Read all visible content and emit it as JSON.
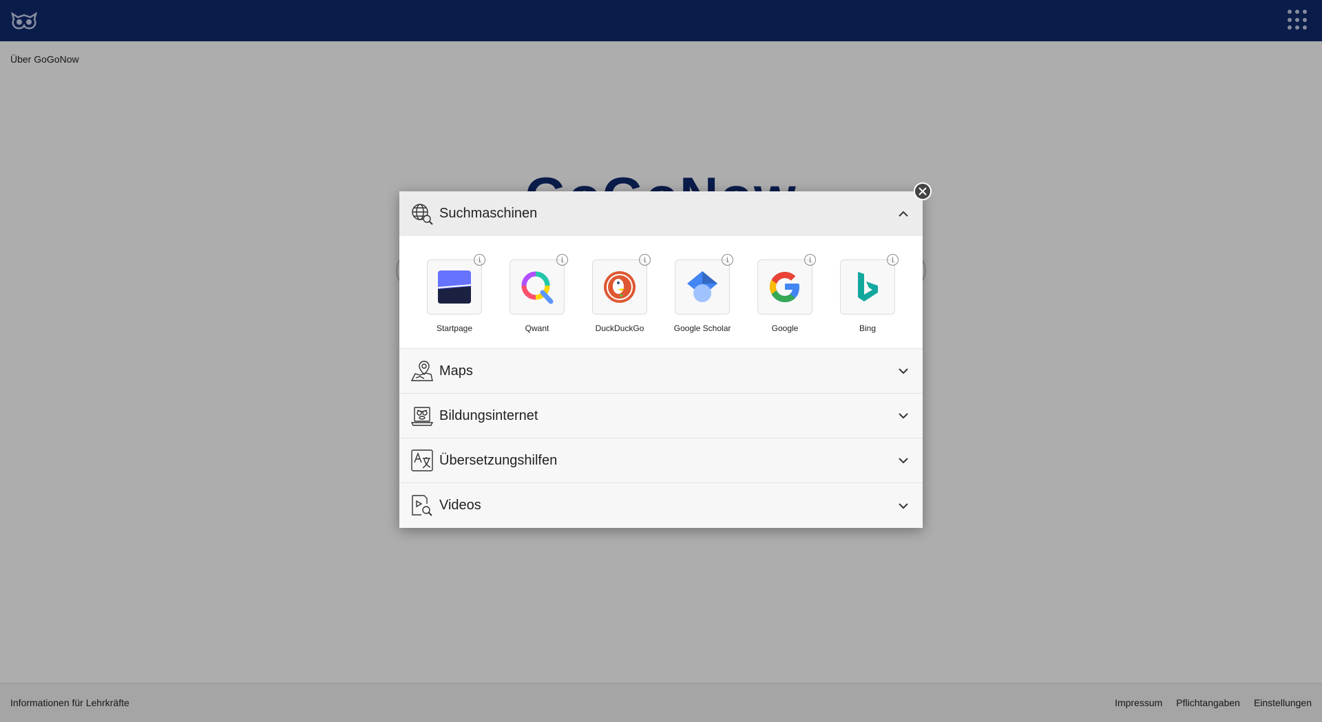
{
  "header": {
    "logo_icon": "owl-logo-icon",
    "apps_icon": "apps-grid-icon"
  },
  "about_link": "Über GoGoNow",
  "hero": {
    "title": "GoGoNow"
  },
  "footer": {
    "left_link": "Informationen für Lehrkräfte",
    "right_links": [
      "Impressum",
      "Pflichtangaben",
      "Einstellungen"
    ]
  },
  "modal": {
    "close_icon": "close-icon",
    "sections": [
      {
        "title": "Suchmaschinen",
        "icon": "globe-search-icon",
        "expanded": true
      },
      {
        "title": "Maps",
        "icon": "map-pin-icon",
        "expanded": false
      },
      {
        "title": "Bildungsinternet",
        "icon": "laptop-owl-icon",
        "expanded": false
      },
      {
        "title": "Übersetzungshilfen",
        "icon": "translate-icon",
        "expanded": false
      },
      {
        "title": "Videos",
        "icon": "video-search-icon",
        "expanded": false
      }
    ],
    "engines": [
      {
        "label": "Startpage",
        "icon": "startpage-icon"
      },
      {
        "label": "Qwant",
        "icon": "qwant-icon"
      },
      {
        "label": "DuckDuckGo",
        "icon": "duckduckgo-icon"
      },
      {
        "label": "Google Scholar",
        "icon": "google-scholar-icon"
      },
      {
        "label": "Google",
        "icon": "google-icon"
      },
      {
        "label": "Bing",
        "icon": "bing-icon"
      }
    ],
    "info_glyph": "i"
  },
  "colors": {
    "header_bg": "#0f2a6e",
    "overlay": "rgba(0,0,0,0.32)"
  }
}
